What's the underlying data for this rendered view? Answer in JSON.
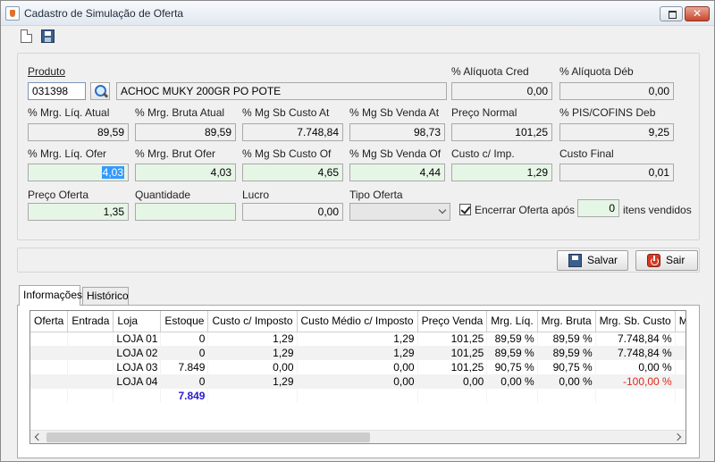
{
  "window": {
    "title": "Cadastro de Simulação de Oferta",
    "close_glyph": "✕"
  },
  "toolbar": {
    "icons": [
      "new-document-icon",
      "save-icon"
    ]
  },
  "produto": {
    "label": "Produto",
    "codigo": "031398",
    "descricao": "ACHOC MUKY 200GR PO POTE",
    "aliquota_cred_label": "% Alíquota Cred",
    "aliquota_cred": "0,00",
    "aliquota_deb_label": "% Alíquota Déb",
    "aliquota_deb": "0,00"
  },
  "atual": {
    "mrg_liq_label": "% Mrg. Líq. Atual",
    "mrg_liq": "89,59",
    "mrg_bruta_label": "% Mrg. Bruta Atual",
    "mrg_bruta": "89,59",
    "mg_sb_custo_label": "% Mg Sb Custo At",
    "mg_sb_custo": "7.748,84",
    "mg_sb_venda_label": "% Mg Sb Venda At",
    "mg_sb_venda": "98,73",
    "preco_normal_label": "Preço Normal",
    "preco_normal": "101,25",
    "pis_cofins_label": "% PIS/COFINS Deb",
    "pis_cofins": "9,25"
  },
  "oferta": {
    "mrg_liq_label": "% Mrg. Líq. Ofer",
    "mrg_liq": "4,03",
    "mrg_brut_label": "% Mrg. Brut Ofer",
    "mrg_brut": "4,03",
    "mg_sb_custo_label": "% Mg Sb Custo Of",
    "mg_sb_custo": "4,65",
    "mg_sb_venda_label": "% Mg Sb Venda Of",
    "mg_sb_venda": "4,44",
    "custo_imp_label": "Custo c/ Imp.",
    "custo_imp": "1,29",
    "custo_final_label": "Custo Final",
    "custo_final": "0,01"
  },
  "preco": {
    "preco_oferta_label": "Preço Oferta",
    "preco_oferta": "1,35",
    "quantidade_label": "Quantidade",
    "quantidade": "",
    "lucro_label": "Lucro",
    "lucro": "0,00",
    "tipo_oferta_label": "Tipo Oferta",
    "tipo_oferta": "",
    "encerrar_label": "Encerrar Oferta após",
    "encerrar_checked": true,
    "itens_qtd": "0",
    "itens_label": "itens vendidos"
  },
  "actions": {
    "salvar": "Salvar",
    "sair": "Sair"
  },
  "tabs": [
    {
      "label": "Informações",
      "active": true
    },
    {
      "label": "Histórico",
      "active": false
    }
  ],
  "grid": {
    "columns": [
      "Oferta",
      "Entrada",
      "Loja",
      "Estoque",
      "Custo c/ Imposto",
      "Custo Médio c/ Imposto",
      "Preço Venda",
      "Mrg. Líq.",
      "Mrg. Bruta",
      "Mrg. Sb. Custo",
      "Mr"
    ],
    "rows": [
      [
        "",
        "",
        "LOJA 01",
        "0",
        "1,29",
        "1,29",
        "101,25",
        "89,59 %",
        "89,59 %",
        "7.748,84 %",
        ""
      ],
      [
        "",
        "",
        "LOJA 02",
        "0",
        "1,29",
        "1,29",
        "101,25",
        "89,59 %",
        "89,59 %",
        "7.748,84 %",
        ""
      ],
      [
        "",
        "",
        "LOJA 03",
        "7.849",
        "0,00",
        "0,00",
        "101,25",
        "90,75 %",
        "90,75 %",
        "0,00 %",
        ""
      ],
      [
        "",
        "",
        "LOJA 04",
        "0",
        "1,29",
        "0,00",
        "0,00",
        "0,00 %",
        "0,00 %",
        "-100,00 %",
        ""
      ]
    ],
    "total_estoque": "7.849",
    "negative_color": "#e0281e",
    "total_color": "#2a1bd0"
  },
  "colors": {
    "selection": "#3399ff",
    "oferta_field_bg": "#e6f6e6"
  }
}
